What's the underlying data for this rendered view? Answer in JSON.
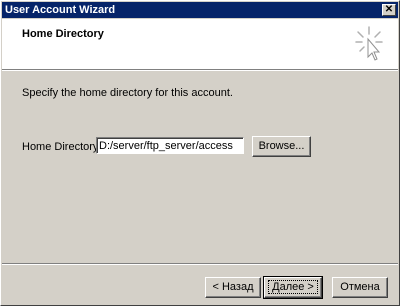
{
  "window": {
    "title": "User Account Wizard"
  },
  "header": {
    "title": "Home Directory"
  },
  "body": {
    "instruction": "Specify the home directory for this account.",
    "home_dir_label": "Home Directory:",
    "home_dir_value": "D:/server/ftp_server/access",
    "browse_label": "Browse..."
  },
  "footer": {
    "back_label": "< Назад",
    "next_label": "Далее >",
    "cancel_label": "Отмена"
  },
  "colors": {
    "titlebar": "#062469",
    "face": "#d4d0c8"
  },
  "icons": [
    "close-icon",
    "wizard-sparkle-icon"
  ]
}
